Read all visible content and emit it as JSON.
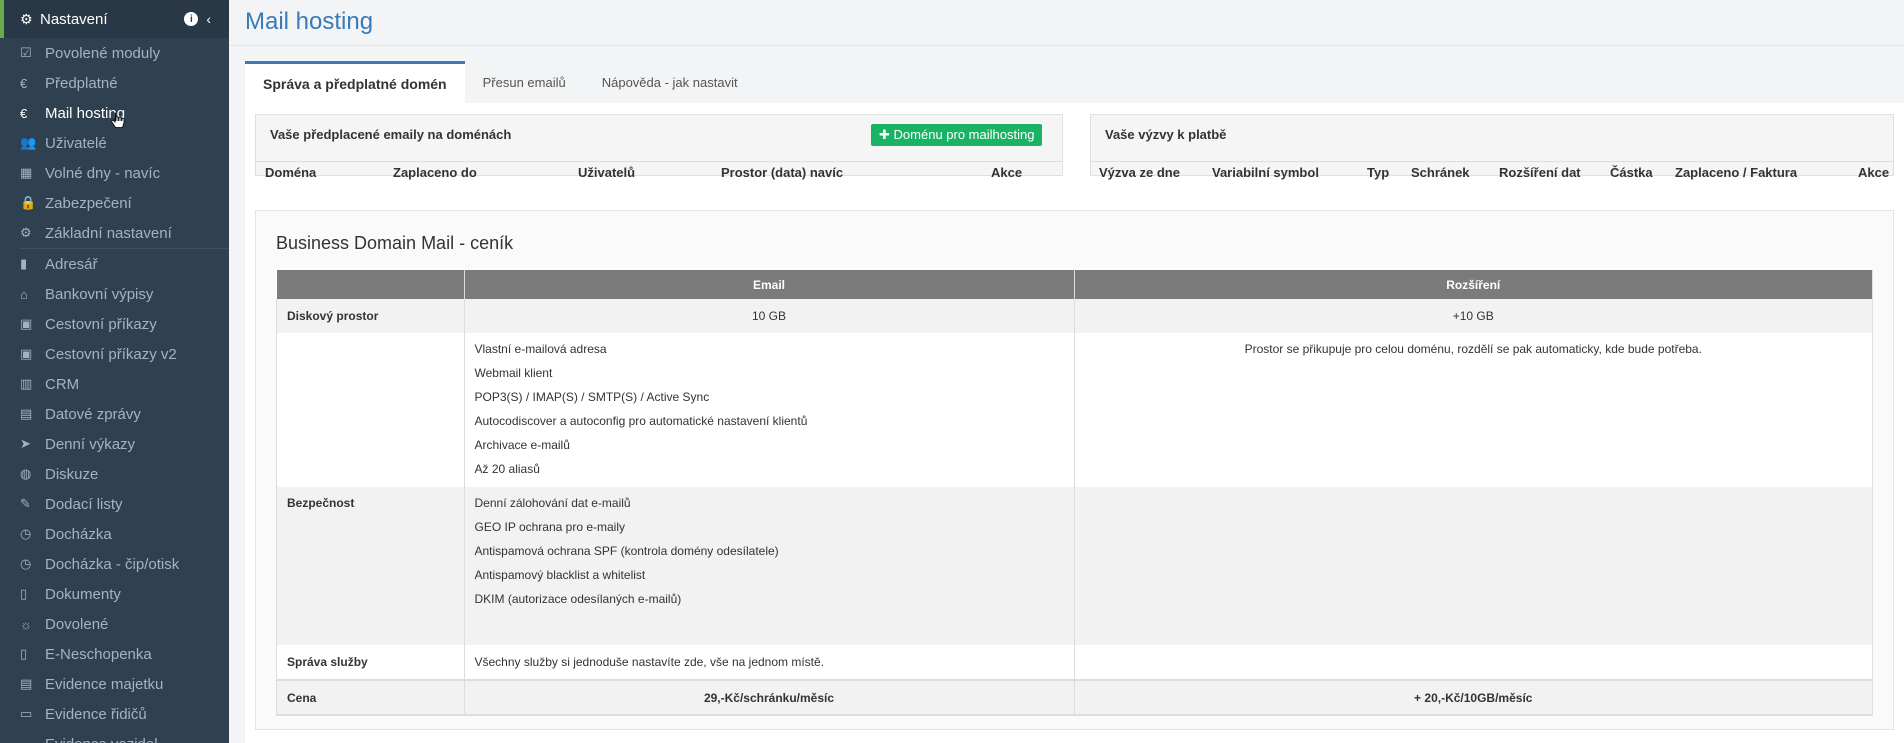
{
  "sidebar": {
    "header": {
      "icon": "gears-icon",
      "title": "Nastavení"
    },
    "items": [
      {
        "icon": "check-square-icon",
        "label": "Povolené moduly"
      },
      {
        "icon": "euro-icon",
        "label": "Předplatné"
      },
      {
        "icon": "euro-icon",
        "label": "Mail hosting",
        "active": true
      },
      {
        "icon": "users-icon",
        "label": "Uživatelé"
      },
      {
        "icon": "calendar-icon",
        "label": "Volné dny - navíc"
      },
      {
        "icon": "lock-icon",
        "label": "Zabezpečení"
      },
      {
        "icon": "gears-icon",
        "label": "Základní nastavení"
      },
      {
        "icon": "book-icon",
        "label": "Adresář"
      },
      {
        "icon": "bank-icon",
        "label": "Bankovní výpisy"
      },
      {
        "icon": "bus-icon",
        "label": "Cestovní příkazy"
      },
      {
        "icon": "bus-icon",
        "label": "Cestovní příkazy v2"
      },
      {
        "icon": "building-icon",
        "label": "CRM"
      },
      {
        "icon": "inbox-icon",
        "label": "Datové zprávy"
      },
      {
        "icon": "paper-plane-icon",
        "label": "Denní výkazy"
      },
      {
        "icon": "comments-icon",
        "label": "Diskuze"
      },
      {
        "icon": "edit-icon",
        "label": "Dodací listy"
      },
      {
        "icon": "clock-icon",
        "label": "Docházka"
      },
      {
        "icon": "clock-icon",
        "label": "Docházka - čip/otisk"
      },
      {
        "icon": "file-icon",
        "label": "Dokumenty"
      },
      {
        "icon": "sun-icon",
        "label": "Dovolené"
      },
      {
        "icon": "file-medical-icon",
        "label": "E-Neschopenka"
      },
      {
        "icon": "clipboard-icon",
        "label": "Evidence majetku"
      },
      {
        "icon": "id-card-icon",
        "label": "Evidence řidičů"
      },
      {
        "icon": "car-icon",
        "label": "Evidence vozidel"
      }
    ]
  },
  "page": {
    "title": "Mail hosting"
  },
  "tabs": [
    {
      "label": "Správa a předplatné domén",
      "active": true
    },
    {
      "label": "Přesun emailů"
    },
    {
      "label": "Nápověda - jak nastavit"
    }
  ],
  "domains_panel": {
    "title": "Vaše předplacené emaily na doménách",
    "button": "Doménu pro mailhosting",
    "columns": [
      "Doména",
      "Zaplaceno do",
      "Uživatelů",
      "Prostor (data) navíc",
      "Akce"
    ]
  },
  "payments_panel": {
    "title": "Vaše výzvy k platbě",
    "columns": [
      "Výzva ze dne",
      "Variabilní symbol",
      "Typ",
      "Schránek",
      "Rozšíření dat",
      "Částka",
      "Zaplaceno / Faktura",
      "Akce"
    ]
  },
  "pricing": {
    "title": "Business Domain Mail - ceník",
    "headers": [
      "",
      "Email",
      "Rozšíření"
    ],
    "disk": {
      "label": "Diskový prostor",
      "email": "10 GB",
      "ext": "+10 GB"
    },
    "features": {
      "email": [
        "Vlastní e-mailová adresa",
        "Webmail klient",
        "POP3(S) / IMAP(S) / SMTP(S) / Active Sync",
        "Autocodiscover a autoconfig pro automatické nastavení klientů",
        "Archivace e-mailů",
        "Až 20 aliasů"
      ],
      "ext": "Prostor se přikupuje pro celou doménu, rozdělí se pak automaticky, kde bude potřeba."
    },
    "security": {
      "label": "Bezpečnost",
      "items": [
        "Denní zálohování dat e-mailů",
        "GEO IP ochrana pro e-maily",
        "Antispamová ochrana SPF (kontrola domény odesílatele)",
        "Antispamový blacklist a whitelist",
        "DKIM (autorizace odesílaných e-mailů)"
      ]
    },
    "management": {
      "label": "Správa služby",
      "text": "Všechny služby si jednoduše nastavíte zde, vše na jednom místě."
    },
    "price": {
      "label": "Cena",
      "email": "29,-Kč/schránku/měsíc",
      "ext": "+ 20,-Kč/10GB/měsíc"
    }
  }
}
